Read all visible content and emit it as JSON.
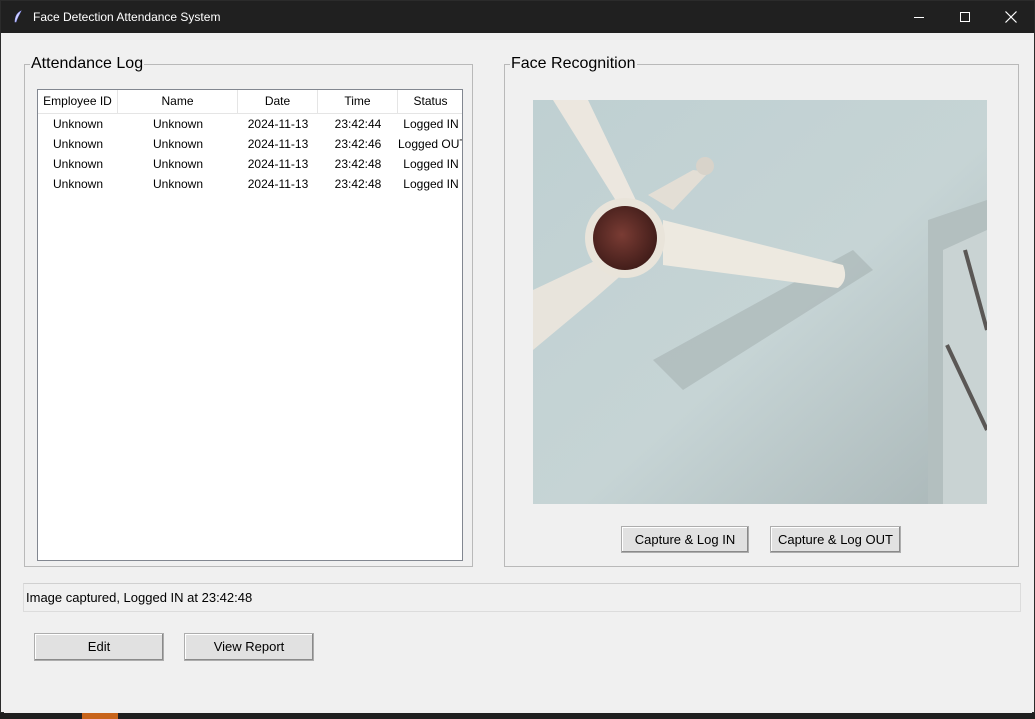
{
  "window": {
    "title": "Face Detection Attendance System",
    "controls": [
      "minimize-icon",
      "maximize-icon",
      "close-icon"
    ]
  },
  "attendance": {
    "legend": "Attendance Log",
    "columns": [
      "Employee ID",
      "Name",
      "Date",
      "Time",
      "Status"
    ],
    "rows": [
      [
        "Unknown",
        "Unknown",
        "2024-11-13",
        "23:42:44",
        "Logged IN"
      ],
      [
        "Unknown",
        "Unknown",
        "2024-11-13",
        "23:42:46",
        "Logged OUT"
      ],
      [
        "Unknown",
        "Unknown",
        "2024-11-13",
        "23:42:48",
        "Logged IN"
      ],
      [
        "Unknown",
        "Unknown",
        "2024-11-13",
        "23:42:48",
        "Logged IN"
      ]
    ]
  },
  "recognition": {
    "legend": "Face Recognition",
    "capture_in_label": "Capture & Log IN",
    "capture_out_label": "Capture & Log OUT"
  },
  "status": {
    "message": "Image captured, Logged IN at 23:42:48"
  },
  "actions": {
    "edit_label": "Edit",
    "view_report_label": "View Report"
  },
  "colors": {
    "titlebar": "#202020",
    "window_bg": "#f0f0f0",
    "button_bg": "#e1e1e1"
  }
}
